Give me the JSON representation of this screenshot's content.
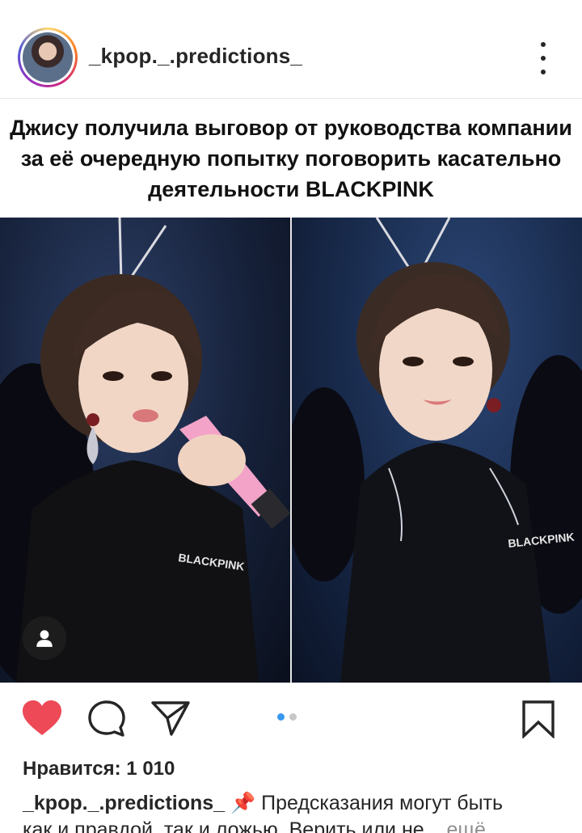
{
  "post": {
    "username": "_kpop._.predictions_",
    "image_title": "Джису получила выговор от руководства компании за её очередную попытку поговорить касательно деятельности BLACKPINK",
    "likes_text": "Нравится: 1 010",
    "caption_user": "_kpop._.predictions_",
    "caption_emoji": "📌",
    "caption_text": "Предсказания могут быть",
    "caption_text_line2": "как и правдой, так и ложью. Верить или не...",
    "more_label": "ещё",
    "carousel_pages": 2,
    "carousel_active": 1
  },
  "icons": {
    "avatar": "profile-avatar",
    "more": "more-options-icon",
    "person_tag": "user-tag-icon",
    "like": "heart-icon",
    "comment": "comment-icon",
    "share": "paper-plane-icon",
    "save": "bookmark-icon"
  },
  "colors": {
    "like_active": "#ed4956",
    "carousel_active": "#3897f0",
    "carousel_inactive": "#c7c7c7",
    "text": "#262626",
    "muted": "#8e8e8e"
  }
}
